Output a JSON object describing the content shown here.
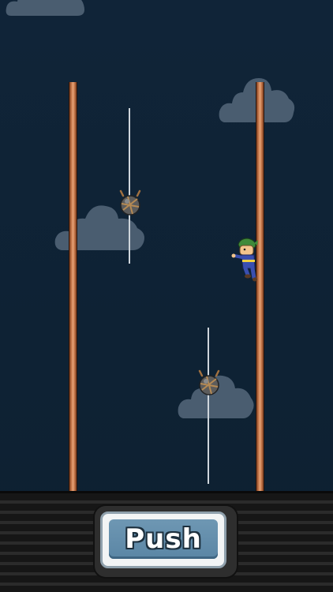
{
  "game": {
    "background_color": "#0f2236",
    "cloud_color": "#4a5d70",
    "pole_color": "#c97b4d",
    "rope_color": "#cfd6dc"
  },
  "controls": {
    "push_label": "Push",
    "button_color": "#5b86a5"
  },
  "icons": {
    "ninja": "ninja-character-icon",
    "bomb": "spiked-bomb-icon",
    "cloud": "cloud-icon"
  }
}
